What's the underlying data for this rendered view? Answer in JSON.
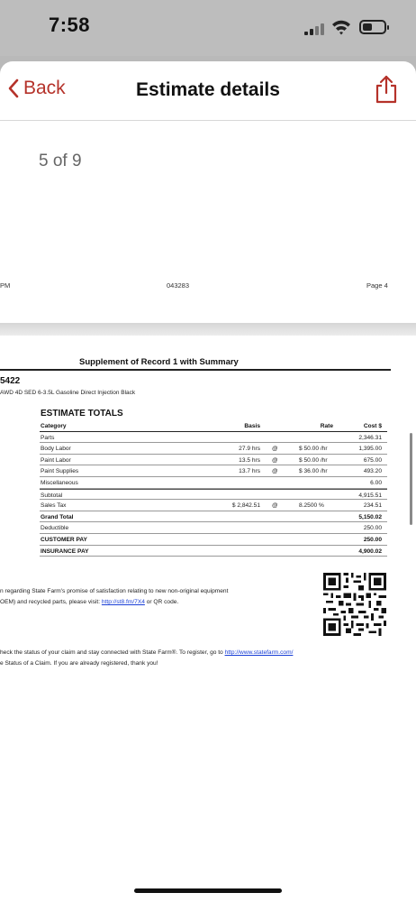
{
  "status_bar": {
    "time": "7:58"
  },
  "nav": {
    "back_label": "Back",
    "title": "Estimate details"
  },
  "viewer": {
    "page_counter": "5 of 9"
  },
  "document": {
    "footer": {
      "left": "PM",
      "center": "043283",
      "right": "Page 4"
    },
    "title": "Supplement of Record 1 with Summary",
    "vin_fragment": "5422",
    "vehicle": "AWD 4D SED 6-3.5L Gasoline Direct Injection Black",
    "estimate_totals": {
      "heading": "ESTIMATE TOTALS",
      "columns": {
        "category": "Category",
        "basis": "Basis",
        "rate": "Rate",
        "cost": "Cost $"
      },
      "rows": [
        {
          "category": "Parts",
          "basis": "",
          "at": "",
          "rate": "",
          "cost": "2,346.31"
        },
        {
          "category": "Body Labor",
          "basis": "27.9 hrs",
          "at": "@",
          "rate": "$ 50.00 /hr",
          "cost": "1,395.00"
        },
        {
          "category": "Paint Labor",
          "basis": "13.5 hrs",
          "at": "@",
          "rate": "$ 50.00 /hr",
          "cost": "675.00"
        },
        {
          "category": "Paint Supplies",
          "basis": "13.7 hrs",
          "at": "@",
          "rate": "$ 36.00 /hr",
          "cost": "493.20"
        },
        {
          "category": "Miscellaneous",
          "basis": "",
          "at": "",
          "rate": "",
          "cost": "6.00"
        },
        {
          "category": "Subtotal",
          "basis": "",
          "at": "",
          "rate": "",
          "cost": "4,915.51"
        },
        {
          "category": "Sales Tax",
          "basis": "$ 2,842.51",
          "at": "@",
          "rate": "8.2500 %",
          "cost": "234.51"
        },
        {
          "category": "Grand Total",
          "basis": "",
          "at": "",
          "rate": "",
          "cost": "5,150.02"
        },
        {
          "category": "Deductible",
          "basis": "",
          "at": "",
          "rate": "",
          "cost": "250.00"
        },
        {
          "category": "CUSTOMER PAY",
          "basis": "",
          "at": "",
          "rate": "",
          "cost": "250.00"
        },
        {
          "category": "INSURANCE PAY",
          "basis": "",
          "at": "",
          "rate": "",
          "cost": "4,900.02"
        }
      ]
    },
    "info": {
      "line1": "n regarding State Farm's promise of satisfaction relating to new non-original equipment",
      "line2_pre": "OEM) and recycled parts, please visit: ",
      "link": "http://st8.fm/7X4",
      "line2_post": " or QR code."
    },
    "register": {
      "line1_pre": "heck the status of your claim and stay connected with State Farm®. To register, go to ",
      "link": "http://www.statefarm.com/",
      "line2": "e Status of a Claim.  If you are already registered, thank you!"
    }
  },
  "colors": {
    "accent": "#b5322a",
    "link": "#1a3fd6"
  }
}
